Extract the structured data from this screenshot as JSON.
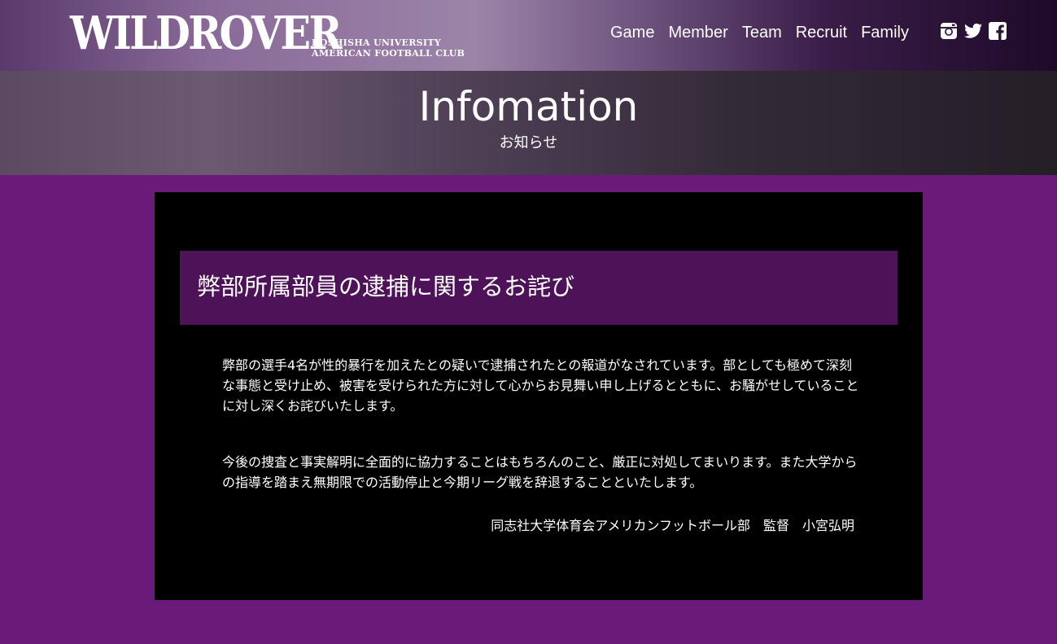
{
  "header": {
    "logo_main": "WILDROVER",
    "logo_sub_line1": "DOSHISHA UNIVERSITY",
    "logo_sub_line2": "AMERICAN FOOTBALL CLUB",
    "nav": [
      "Game",
      "Member",
      "Team",
      "Recruit",
      "Family"
    ],
    "social_icons": [
      "instagram-icon",
      "twitter-icon",
      "facebook-icon"
    ]
  },
  "banner": {
    "title": "Infomation",
    "subtitle": "お知らせ"
  },
  "notice": {
    "title": "弊部所属部員の逮捕に関するお詫び",
    "paragraph1": "弊部の選手4名が性的暴行を加えたとの疑いで逮捕されたとの報道がなされています。部としても極めて深刻な事態と受け止め、被害を受けられた方に対して心からお見舞い申し上げるとともに、お騒がせしていることに対し深くお詫びいたします。",
    "paragraph2": "今後の捜査と事実解明に全面的に協力することはもちろんのこと、厳正に対処してまいります。また大学からの指導を踏まえ無期限での活動停止と今期リーグ戦を辞退することといたします。",
    "signature": "同志社大学体育会アメリカンフットボール部　監督　小宮弘明"
  },
  "colors": {
    "page_background": "#6a1b7a",
    "panel_background": "#000000",
    "notice_header_background": "#4d1257",
    "text": "#ffffff"
  }
}
